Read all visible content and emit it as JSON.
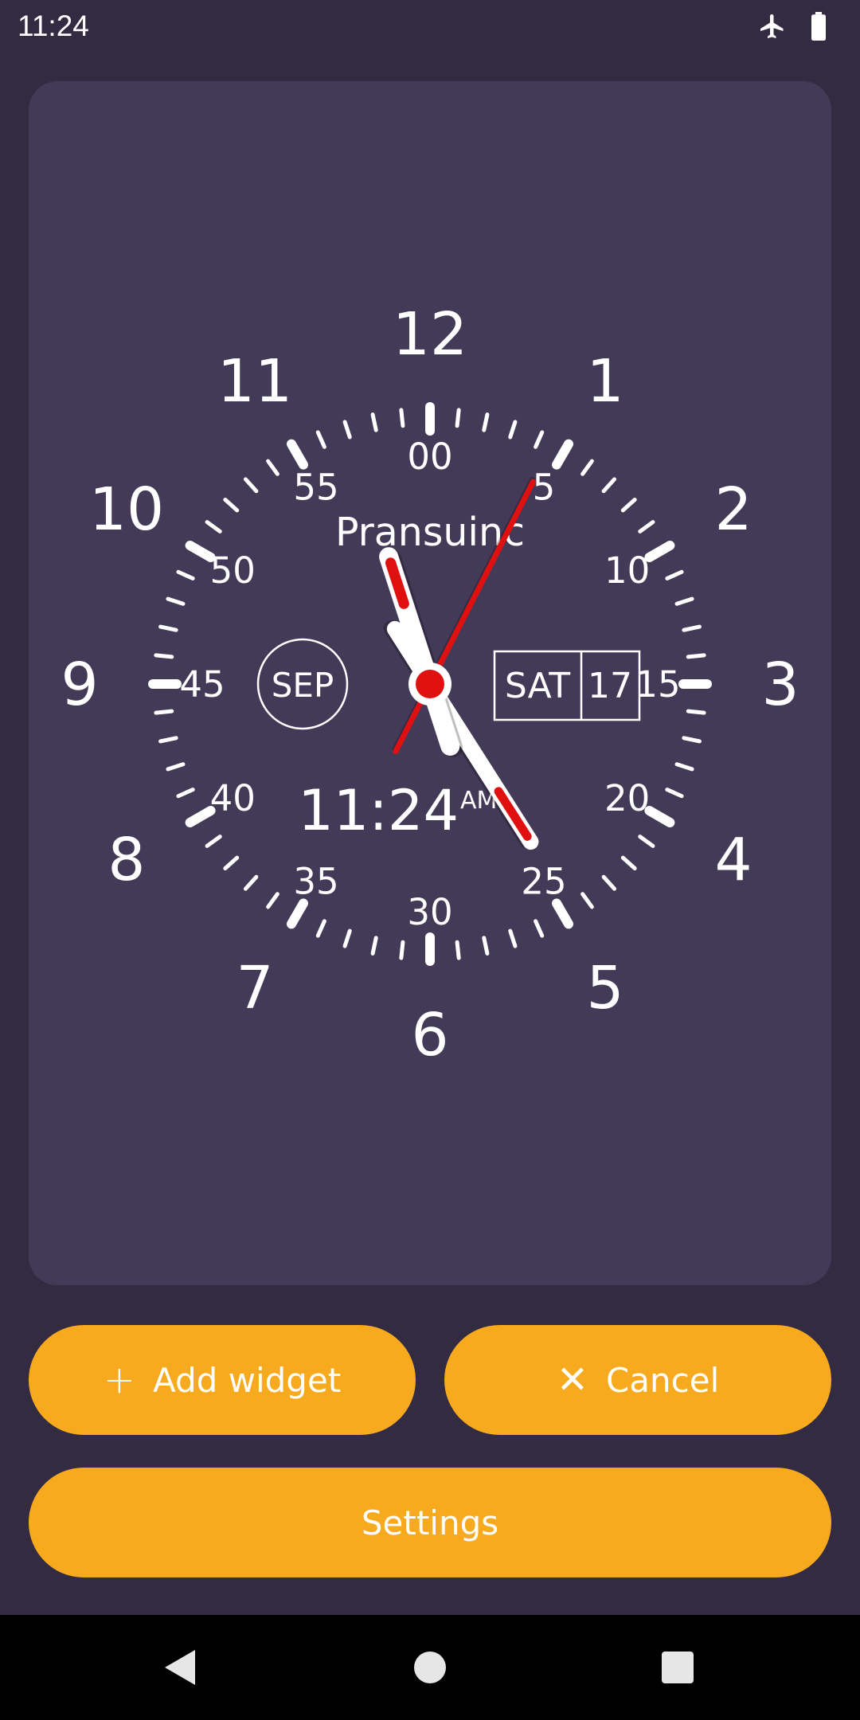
{
  "status_bar": {
    "time": "11:24",
    "icons": [
      "airplane-mode-icon",
      "battery-full-icon"
    ]
  },
  "widget_preview": {
    "brand": "Pransuinc",
    "month": "SEP",
    "weekday": "SAT",
    "day": "17",
    "digital_time": "11:24",
    "ampm": "AM",
    "hour_numerals": [
      "12",
      "1",
      "2",
      "3",
      "4",
      "5",
      "6",
      "7",
      "8",
      "9",
      "10",
      "11"
    ],
    "minute_numerals": [
      "00",
      "5",
      "10",
      "15",
      "20",
      "25",
      "30",
      "35",
      "40",
      "45",
      "50",
      "55"
    ],
    "time_shown": {
      "hour": 11,
      "minute": 24,
      "second": 34.5
    },
    "colors": {
      "hand": "#ffffff",
      "accent": "#e11010",
      "dial": "#433a58"
    }
  },
  "actions": {
    "add_widget_label": "Add widget",
    "add_widget_icon": "plus-icon",
    "cancel_label": "Cancel",
    "cancel_icon": "close-icon",
    "settings_label": "Settings"
  },
  "nav_bar": {
    "buttons": [
      "back-icon",
      "home-icon",
      "recents-icon"
    ]
  },
  "theme": {
    "background": "#332b42",
    "card": "#433a58",
    "accent": "#f8aa1e",
    "nav_background": "#000000"
  }
}
